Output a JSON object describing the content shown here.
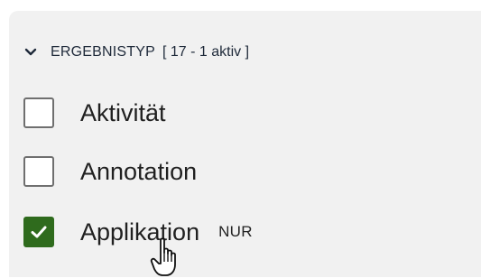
{
  "filter": {
    "title": "ERGEBNISTYP",
    "count_text": "[ 17 - 1 aktiv ]",
    "options": [
      {
        "label": "Aktivität",
        "checked": false,
        "badge": ""
      },
      {
        "label": "Annotation",
        "checked": false,
        "badge": ""
      },
      {
        "label": "Applikation",
        "checked": true,
        "badge": "NUR"
      }
    ]
  },
  "icons": {
    "expand": "chevron-down-icon",
    "check": "check-icon",
    "cursor": "hand-pointer-icon"
  },
  "colors": {
    "panel_background": "#f1f1f1",
    "checked_box": "#2f6b1d",
    "text": "#202020"
  }
}
